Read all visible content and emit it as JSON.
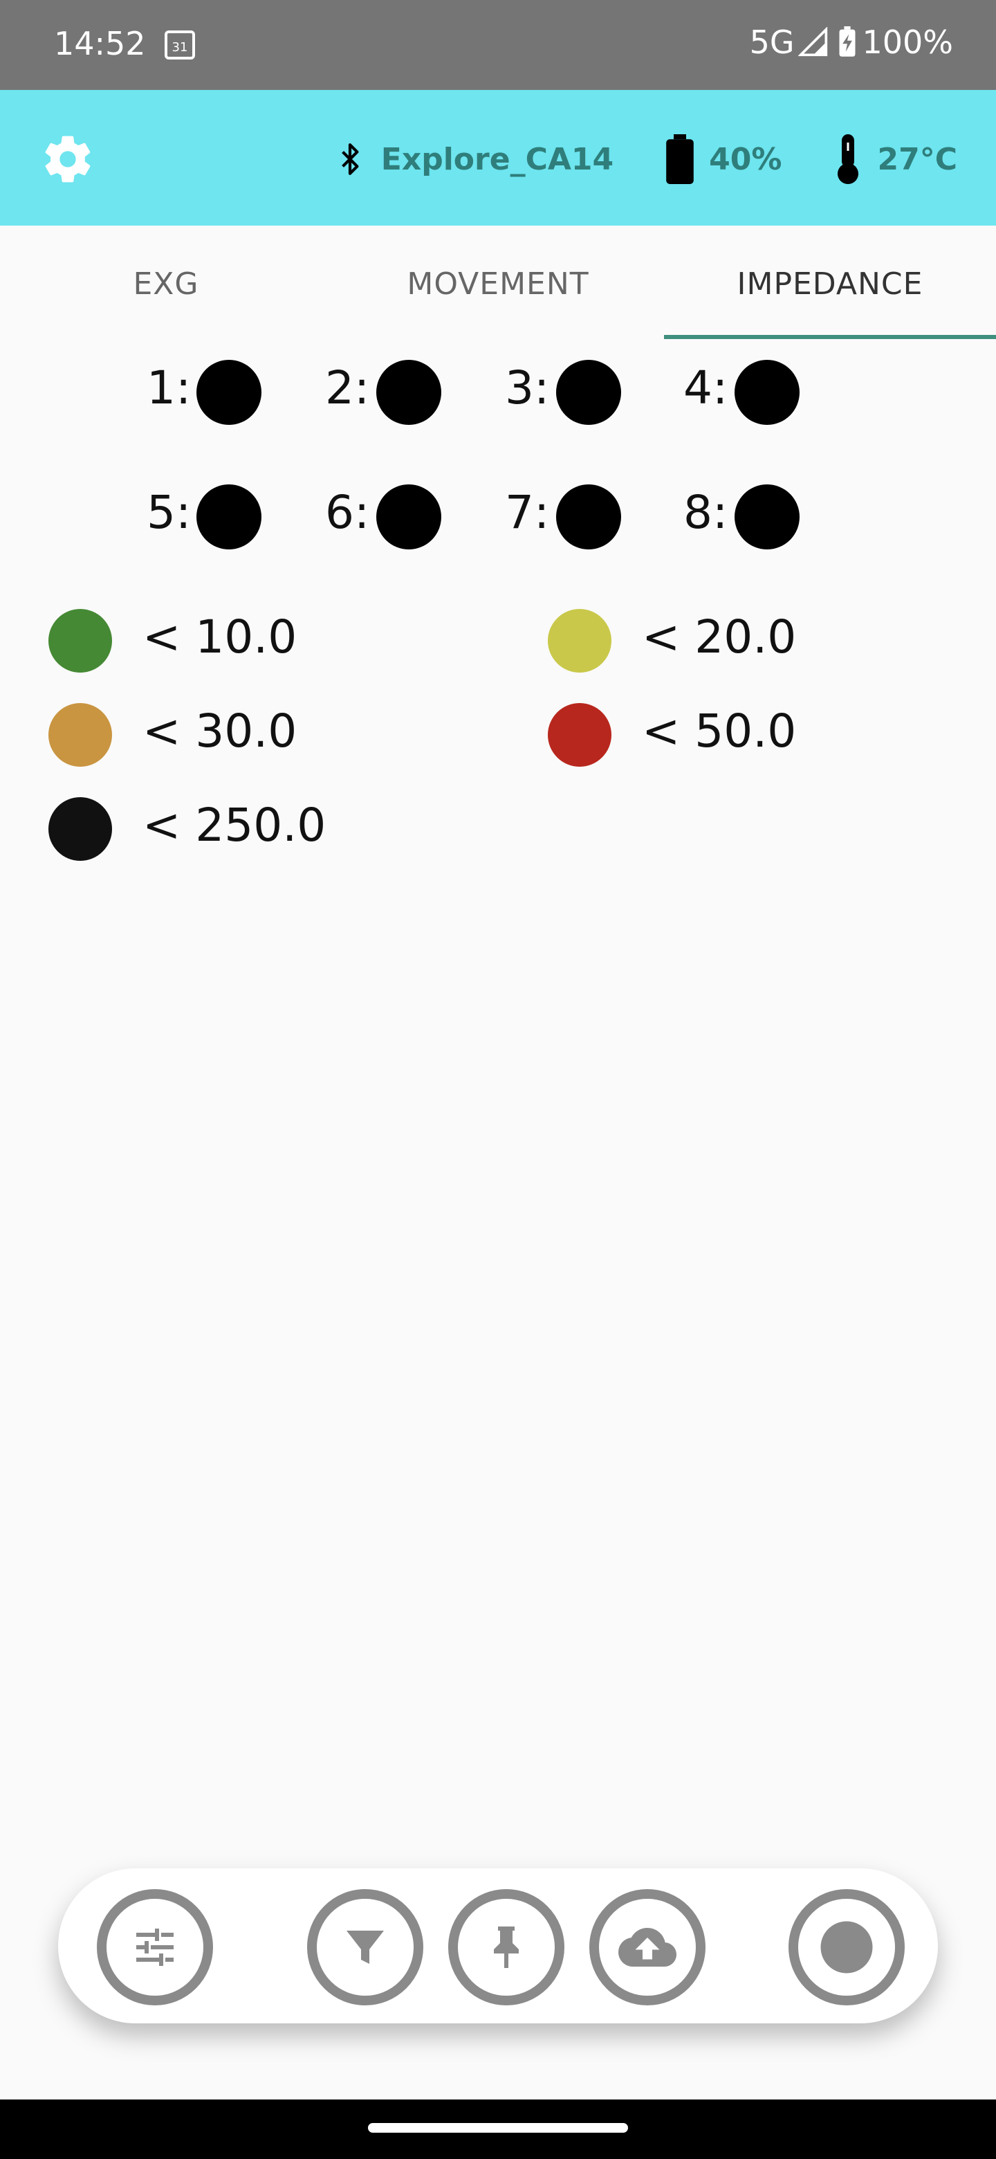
{
  "status_bar": {
    "time": "14:52",
    "calendar_day": "31",
    "network": "5G",
    "battery": "100%"
  },
  "app_bar": {
    "device_name": "Explore_CA14",
    "battery": "40%",
    "temperature": "27°C",
    "accent_color": "#6ee5ef"
  },
  "tabs": [
    {
      "label": "EXG",
      "active": false
    },
    {
      "label": "MOVEMENT",
      "active": false
    },
    {
      "label": "IMPEDANCE",
      "active": true
    }
  ],
  "channels": [
    {
      "label": "1:",
      "color": "#000000"
    },
    {
      "label": "2:",
      "color": "#000000"
    },
    {
      "label": "3:",
      "color": "#000000"
    },
    {
      "label": "4:",
      "color": "#000000"
    },
    {
      "label": "5:",
      "color": "#000000"
    },
    {
      "label": "6:",
      "color": "#000000"
    },
    {
      "label": "7:",
      "color": "#000000"
    },
    {
      "label": "8:",
      "color": "#000000"
    }
  ],
  "legend": [
    {
      "label": "< 10.0",
      "color": "#458934"
    },
    {
      "label": "< 20.0",
      "color": "#c9c84a"
    },
    {
      "label": "< 30.0",
      "color": "#c99541"
    },
    {
      "label": "< 50.0",
      "color": "#b8271d"
    },
    {
      "label": "< 250.0",
      "color": "#111111"
    }
  ],
  "bottom_actions": [
    {
      "icon": "sliders-icon"
    },
    {
      "icon": "filter-icon"
    },
    {
      "icon": "pin-icon"
    },
    {
      "icon": "cloud-upload-icon"
    },
    {
      "icon": "record-icon"
    }
  ]
}
